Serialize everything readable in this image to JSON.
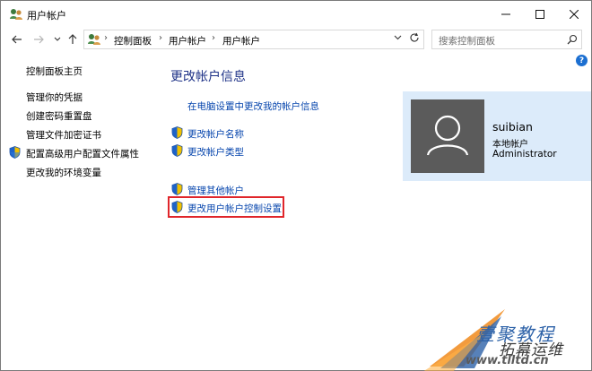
{
  "window": {
    "title": "用户帐户",
    "icon": "users-icon"
  },
  "address": {
    "crumbs": [
      "控制面板",
      "用户帐户",
      "用户帐户"
    ],
    "search_placeholder": "搜索控制面板"
  },
  "sidebar": {
    "home": "控制面板主页",
    "items": [
      {
        "label": "管理你的凭据",
        "shield": false
      },
      {
        "label": "创建密码重置盘",
        "shield": false
      },
      {
        "label": "管理文件加密证书",
        "shield": false
      },
      {
        "label": "配置高级用户配置文件属性",
        "shield": true
      },
      {
        "label": "更改我的环境变量",
        "shield": false
      }
    ]
  },
  "main": {
    "title": "更改帐户信息",
    "pc_settings_link": "在电脑设置中更改我的帐户信息",
    "links": [
      {
        "label": "更改帐户名称",
        "shield": true
      },
      {
        "label": "更改帐户类型",
        "shield": true
      },
      {
        "label": "管理其他帐户",
        "shield": true
      },
      {
        "label": "更改用户帐户控制设置",
        "shield": true
      }
    ]
  },
  "account": {
    "name": "suibian",
    "type": "本地帐户",
    "role": "Administrator"
  },
  "watermark": {
    "line1": "壹聚教程",
    "line2": "拓幕运维",
    "line3": "www.tlltd.cn"
  },
  "colors": {
    "link": "#0645ad",
    "title": "#1e3287",
    "card_bg": "#dcebfa",
    "highlight": "#e0262b"
  }
}
